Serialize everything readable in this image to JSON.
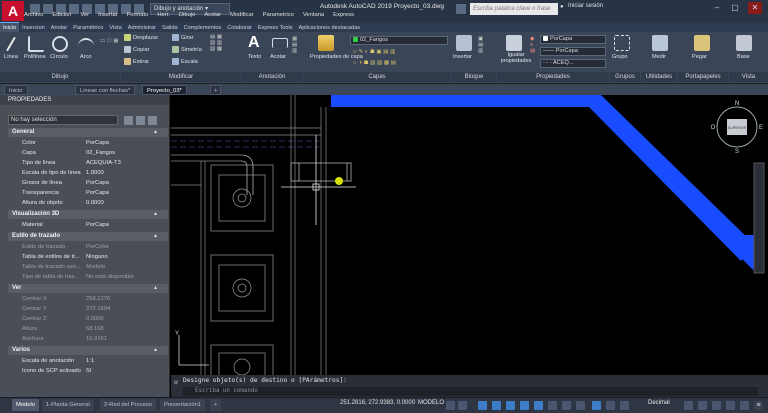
{
  "titlebar": {
    "workspace": "Dibujo y anotación",
    "title": "Autodesk AutoCAD 2019  Proyecto_03.dwg",
    "search_placeholder": "Escriba palabra clave o frase",
    "login": "Iniciar sesión",
    "logo": "A"
  },
  "menubar": [
    "Archivo",
    "Edición",
    "Ver",
    "Insertar",
    "Formato",
    "Herr.",
    "Dibujo",
    "Acotar",
    "Modificar",
    "Parametrico",
    "Ventana",
    "Express"
  ],
  "ribbon_tabs": [
    "Inicio",
    "Insercion",
    "Anotar",
    "Paramétrico",
    "Vista",
    "Administrar",
    "Salida",
    "Complementos",
    "Colaborar",
    "Express Tools",
    "Aplicaciones destacadas"
  ],
  "ribbon": {
    "draw_tools": [
      "Línea",
      "Polilínea",
      "Círculo",
      "Arco"
    ],
    "modify_tools": [
      "Desplazar",
      "Girar",
      "Copiar",
      "Simetría",
      "Estirar",
      "Escala"
    ],
    "annotation_tools": [
      "Texto",
      "Acotar"
    ],
    "layer_props": "Propiedades de capa",
    "layer_combo": "02_Fangos",
    "insert": "Insertar",
    "match_props": "Igualar propiedades",
    "porcapa1": "PorCapa",
    "porcapa2": "PorCapa",
    "linetype": "ACEQ...",
    "group": "Grupo",
    "measure": "Medir",
    "paste": "Pegar",
    "base": "Base",
    "panels": [
      "Dibujo",
      "Modificar",
      "Anotación",
      "Capas",
      "Bloque",
      "Propiedades",
      "Grupos",
      "Utilidades",
      "Portapapeles",
      "Vista"
    ]
  },
  "doc_tabs": [
    "Inicio",
    "Lineas con flechas*",
    "Proyecto_03*"
  ],
  "properties": {
    "title": "PROPIEDADES",
    "selection": "No hay selección",
    "sections": {
      "general": "General",
      "visual3d": "Visualización 3D",
      "plot": "Estilo de trazado",
      "view": "Ver",
      "misc": "Varios"
    },
    "general_rows": [
      {
        "k": "Color",
        "v": "PorCapa"
      },
      {
        "k": "Capa",
        "v": "02_Fangos"
      },
      {
        "k": "Tipo de línea",
        "v": "ACEQUIA-T3"
      },
      {
        "k": "Escala de tipo de línea",
        "v": "1.0000"
      },
      {
        "k": "Grosor de línea",
        "v": "PorCapa"
      },
      {
        "k": "Transparencia",
        "v": "PorCapa"
      },
      {
        "k": "Altura de objeto",
        "v": "0.0000"
      }
    ],
    "visual_rows": [
      {
        "k": "Material",
        "v": "PorCapa"
      }
    ],
    "plot_rows": [
      {
        "k": "Estilo de trazado",
        "v": "PorColor"
      },
      {
        "k": "Tabla de estilos de tr...",
        "v": "Ninguno"
      },
      {
        "k": "Tabla de trazado aso...",
        "v": "Modelo"
      },
      {
        "k": "Tipo de tabla de traz...",
        "v": "No está disponible"
      }
    ],
    "view_rows": [
      {
        "k": "Centrar X",
        "v": "258.1276"
      },
      {
        "k": "Centrar Y",
        "v": "272.1694"
      },
      {
        "k": "Centrar Z",
        "v": "0.0000"
      },
      {
        "k": "Altura",
        "v": "68.168"
      },
      {
        "k": "Anchura",
        "v": "10.9161"
      }
    ],
    "misc_rows": [
      {
        "k": "Escala de anotación",
        "v": "1:1"
      },
      {
        "k": "Icono de SCP activado",
        "v": "Sí"
      }
    ]
  },
  "viewcube": {
    "n": "N",
    "s": "S",
    "e": "E",
    "w": "O",
    "face": "SUPERIOR"
  },
  "command": {
    "history": "Designe objeto(s) de destino o [PArámetros]:",
    "prompt": "Escriba un comando"
  },
  "layout_tabs": [
    "Modelo",
    "1-Planta General",
    "2-Red del Proceso",
    "Presentación1"
  ],
  "status": {
    "coords": "251.2816, 272.9383, 0.0000",
    "mode": "MODELO",
    "units": "Decimal"
  },
  "colors": {
    "accent": "#1a4cff",
    "selection": "#d8e000"
  }
}
